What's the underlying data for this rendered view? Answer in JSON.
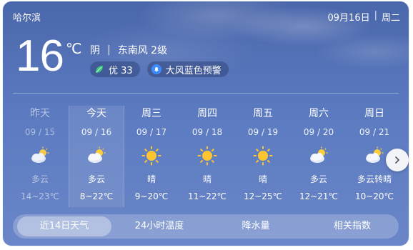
{
  "header": {
    "city": "哈尔滨",
    "date": "09月16日",
    "weekday": "周二"
  },
  "current": {
    "temperature": "16",
    "unit": "℃",
    "condition": "阴",
    "wind": "东南风 2级",
    "aqi_label": "优 33",
    "alert_label": "大风蓝色预警"
  },
  "forecast": [
    {
      "name": "昨天",
      "date": "09 / 15",
      "desc": "多云",
      "range": "14~23℃",
      "icon": "partly-cloudy"
    },
    {
      "name": "今天",
      "date": "09 / 16",
      "desc": "多云",
      "range": "8~22℃",
      "icon": "partly-cloudy"
    },
    {
      "name": "周三",
      "date": "09 / 17",
      "desc": "晴",
      "range": "9~20℃",
      "icon": "sunny"
    },
    {
      "name": "周四",
      "date": "09 / 18",
      "desc": "晴",
      "range": "11~22℃",
      "icon": "sunny"
    },
    {
      "name": "周五",
      "date": "09 / 19",
      "desc": "晴",
      "range": "12~25℃",
      "icon": "sunny"
    },
    {
      "name": "周六",
      "date": "09 / 20",
      "desc": "多云",
      "range": "12~21℃",
      "icon": "partly-cloudy"
    },
    {
      "name": "周日",
      "date": "09 / 21",
      "desc": "多云转晴",
      "range": "10~20℃",
      "icon": "partly-cloudy"
    }
  ],
  "tabs": [
    {
      "label": "近14日天气"
    },
    {
      "label": "24小时温度"
    },
    {
      "label": "降水量"
    },
    {
      "label": "相关指数"
    }
  ]
}
